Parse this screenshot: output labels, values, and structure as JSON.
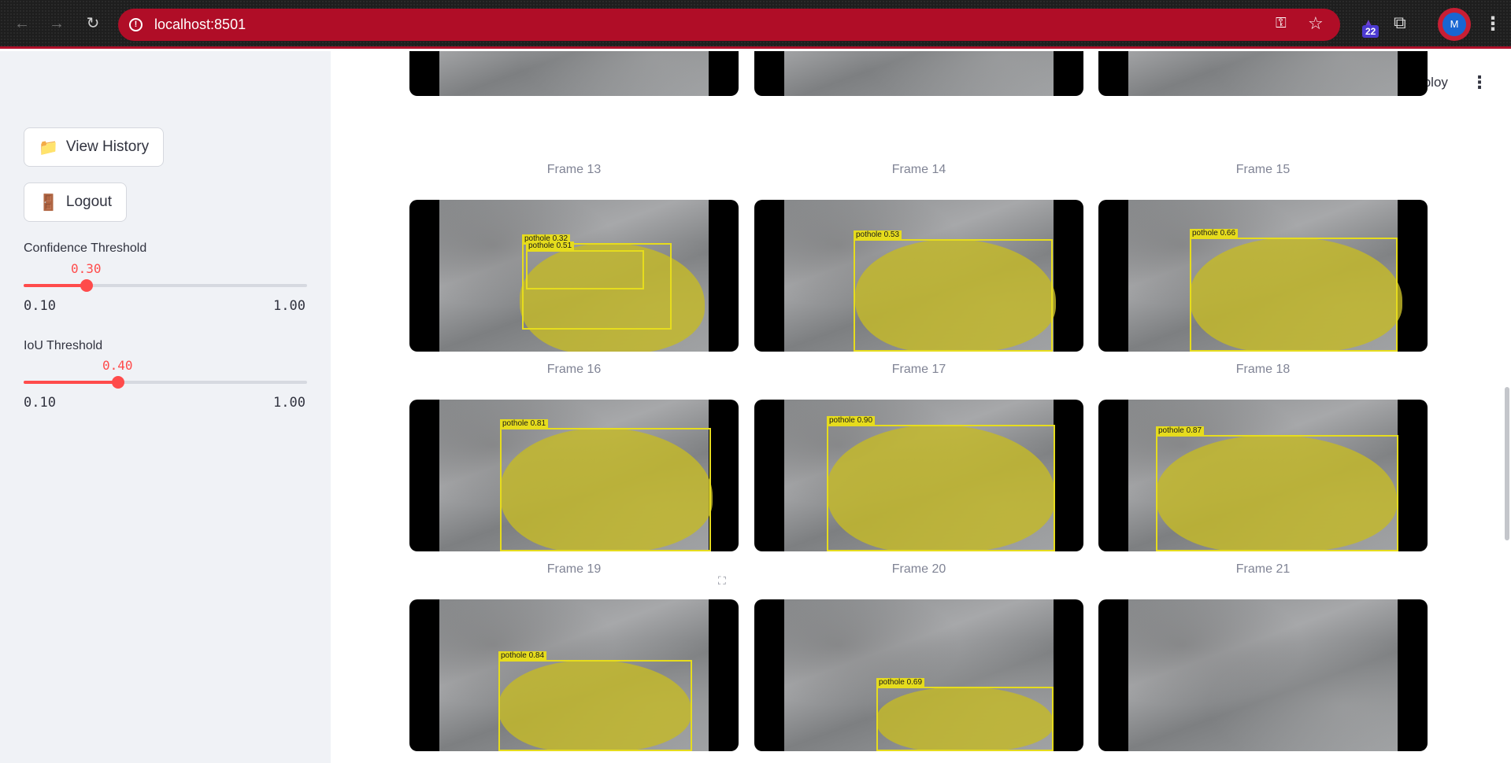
{
  "browser": {
    "url": "localhost:8501",
    "extension_badge": "22",
    "profile_initial": "M"
  },
  "sidebar": {
    "view_history_label": "View History",
    "view_history_icon": "folder-icon",
    "logout_label": "Logout",
    "logout_icon": "door-icon",
    "confidence": {
      "label": "Confidence Threshold",
      "value": "0.30",
      "min": "0.10",
      "max": "1.00",
      "fraction": 0.2222
    },
    "iou": {
      "label": "IoU Threshold",
      "value": "0.40",
      "min": "0.10",
      "max": "1.00",
      "fraction": 0.3333
    }
  },
  "header": {
    "deploy_label": "Deploy"
  },
  "frames": [
    {
      "caption": "Frame 13",
      "detections": []
    },
    {
      "caption": "Frame 14",
      "detections": []
    },
    {
      "caption": "Frame 15",
      "detections": []
    },
    {
      "caption": "Frame 16",
      "detections": [
        {
          "label": "pothole 0.32"
        },
        {
          "label": "pothole 0.51"
        }
      ]
    },
    {
      "caption": "Frame 17",
      "detections": [
        {
          "label": "pothole 0.53"
        }
      ]
    },
    {
      "caption": "Frame 18",
      "detections": [
        {
          "label": "pothole 0.66"
        }
      ]
    },
    {
      "caption": "Frame 19",
      "detections": [
        {
          "label": "pothole 0.81"
        }
      ]
    },
    {
      "caption": "Frame 20",
      "detections": [
        {
          "label": "pothole 0.90"
        }
      ]
    },
    {
      "caption": "Frame 21",
      "detections": [
        {
          "label": "pothole 0.87"
        }
      ]
    },
    {
      "caption": "",
      "detections": [
        {
          "label": "pothole 0.84"
        }
      ]
    },
    {
      "caption": "",
      "detections": [
        {
          "label": "pothole 0.69"
        }
      ]
    },
    {
      "caption": "",
      "detections": []
    }
  ],
  "colors": {
    "accent": "#ff4b4b",
    "browser_frame": "#b00d27",
    "detection": "#e6dc1d"
  }
}
